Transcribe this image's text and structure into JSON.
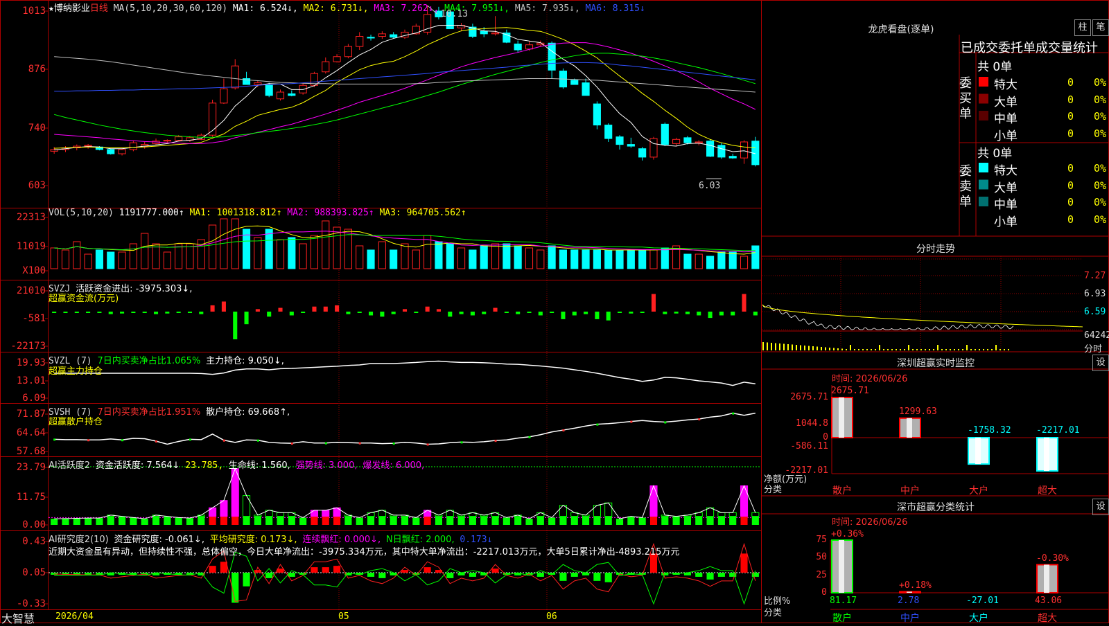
{
  "stock": {
    "star": "★",
    "name": "博纳影业",
    "period": "日线"
  },
  "colors": {
    "up": "#ff2020",
    "down": "#00ffff",
    "grid": "#8b0000",
    "panel_border": "#b00000",
    "ma1": "#ffffff",
    "ma2": "#ffff00",
    "ma3": "#ff00ff",
    "ma4": "#00ff00",
    "ma5": "#c0c0c0",
    "ma6": "#3050ff"
  },
  "kline_header": {
    "ma_def": "MA(5,10,20,30,60,120)",
    "items": [
      {
        "text": "MA1: 6.524↓",
        "color": "#ffffff"
      },
      {
        "text": "MA2: 6.731↓",
        "color": "#ffff00"
      },
      {
        "text": "MA3: 7.262↓",
        "color": "#ff00ff"
      },
      {
        "text": "MA4: 7.951↓",
        "color": "#00ff00"
      },
      {
        "text": "MA5: 7.935↓",
        "color": "#c0c0c0"
      },
      {
        "text": "MA6: 8.315↓",
        "color": "#3050ff"
      }
    ],
    "high_mark": "10.13",
    "low_mark": "6.03"
  },
  "vol_header": {
    "def": "VOL(5,10,20)",
    "v": "1191777.000↑",
    "ma1": "MA1: 1001318.812↑",
    "ma2": "MA2: 988393.825↑",
    "ma3": "MA3: 964705.562↑"
  },
  "svzj_header": {
    "def": "SVZJ",
    "label": "活跃资金进出: -3975.303↓,",
    "sub": "超赢资金流(万元)"
  },
  "svzl_header": {
    "def": "SVZL (7)",
    "label1": "7日内买卖净占比1.065%",
    "label2": "主力持仓: 9.050↓,",
    "sub": "超赢主力持仓"
  },
  "svsh_header": {
    "def": "SVSH (7)",
    "label1": "7日内买卖净占比1.951%",
    "label2": "散户持仓: 69.668↑,",
    "sub": "超赢散户持仓"
  },
  "ai2_header": {
    "def": "AI活跃度2",
    "l1": "资金活跃度: 7.564↓",
    "l2": "23.785,",
    "l3": "生命线: 1.560,",
    "l4": "强势线: 3.000,",
    "l5": "爆发线: 6.000,"
  },
  "ai3_header": {
    "def": "AI研究度2(10)",
    "l1": "资金研究度: -0.061↓,",
    "l2": "平均研究度: 0.173↓,",
    "l3": "连续飘红: 0.000↓,",
    "l4": "N日飘红: 2.000,",
    "l5": "0.173↓",
    "note": "近期大资金虽有异动，但持续性不强，总体偏空，今日大单净流出：-3975.334万元，其中特大单净流出：-2217.013万元，大单5日累计净出-4893.215万元"
  },
  "axes": {
    "price": [
      "1013",
      "876",
      "740",
      "603"
    ],
    "vol": [
      "22313",
      "11019",
      "X100"
    ],
    "svzj": [
      "21010",
      "-581",
      "-22173"
    ],
    "svzl": [
      "19.93",
      "13.01",
      "6.09"
    ],
    "svsh": [
      "71.87",
      "64.64",
      "57.68"
    ],
    "ai2": [
      "23.79",
      "11.75",
      "0.00"
    ],
    "ai3": [
      "0.43",
      "0.05",
      "-0.33"
    ]
  },
  "date_axis": {
    "brand": "大智慧",
    "d1": "2026/04",
    "d2": "05",
    "d3": "06"
  },
  "right": {
    "lhb_title": "龙虎看盘(逐单)",
    "btn_bar": "柱",
    "btn_pen": "笔",
    "stat_title": "已成交委托单成交量统计",
    "buy_side": "委买单",
    "sell_side": "委卖单",
    "buy_total": "共 0单",
    "sell_total": "共 0单",
    "rows": [
      {
        "name": "特大",
        "count": "0",
        "pct": "0%"
      },
      {
        "name": "大单",
        "count": "0",
        "pct": "0%"
      },
      {
        "name": "中单",
        "count": "0",
        "pct": "0%"
      },
      {
        "name": "小单",
        "count": "0",
        "pct": "0%"
      }
    ],
    "buy_colors": [
      "#ff0000",
      "#8b0000",
      "#5a0000",
      ""
    ],
    "sell_colors": [
      "#00ffff",
      "#008b8b",
      "#007070",
      ""
    ],
    "minute_title": "分时走势",
    "minute_axis": [
      "7.27",
      "6.93",
      "6.59",
      "64242",
      "分时"
    ],
    "sz_title": "深圳超赢实时监控",
    "sz_time": "时间: 2026/06/26",
    "sz_axis": [
      "2675.71",
      "1044.8",
      "0",
      "-586.11",
      "-2217.01"
    ],
    "sz_net": "净额(万元)",
    "sz_cat": "分类",
    "sz_bars": [
      {
        "cat": "散户",
        "value": 2675.71,
        "label": "2675.71"
      },
      {
        "cat": "中户",
        "value": 1299.63,
        "label": "1299.63"
      },
      {
        "cat": "大户",
        "value": -1758.32,
        "label": "-1758.32"
      },
      {
        "cat": "超大",
        "value": -2217.01,
        "label": "-2217.01"
      }
    ],
    "set_label": "设",
    "sc_title": "深市超赢分类统计",
    "sc_time": "时间: 2026/06/26",
    "sc_axis": [
      "75",
      "50",
      "25",
      "0"
    ],
    "sc_ratio": "比例%",
    "sc_cat": "分类",
    "sc_bars": [
      {
        "cat": "散户",
        "pct": "+0.36%",
        "level": 75,
        "value": "81.17"
      },
      {
        "cat": "中户",
        "pct": "+0.18%",
        "level": 1.5,
        "value": "2.78"
      },
      {
        "cat": "大户",
        "pct": "",
        "level": 0,
        "value": "-27.01"
      },
      {
        "cat": "超大",
        "pct": "-0.30%",
        "level": 40,
        "value": "43.06"
      }
    ]
  },
  "chart_data": {
    "type": "candlestick",
    "candles": [
      [
        6.68,
        6.78,
        6.62,
        6.72
      ],
      [
        6.72,
        6.8,
        6.66,
        6.76
      ],
      [
        6.76,
        6.84,
        6.7,
        6.8
      ],
      [
        6.8,
        6.85,
        6.74,
        6.82
      ],
      [
        6.78,
        6.8,
        6.7,
        6.72
      ],
      [
        6.72,
        6.74,
        6.6,
        6.62
      ],
      [
        6.62,
        6.74,
        6.58,
        6.72
      ],
      [
        6.72,
        6.92,
        6.68,
        6.88
      ],
      [
        6.8,
        6.9,
        6.74,
        6.84
      ],
      [
        6.86,
        6.98,
        6.84,
        6.92
      ],
      [
        6.92,
        6.96,
        6.88,
        6.94
      ],
      [
        6.94,
        7.06,
        6.92,
        7.02
      ],
      [
        6.94,
        7.04,
        6.9,
        7.0
      ],
      [
        6.96,
        7.1,
        6.94,
        7.06
      ],
      [
        7.06,
        7.9,
        7.02,
        7.82
      ],
      [
        7.82,
        8.4,
        7.8,
        8.16
      ],
      [
        8.18,
        8.86,
        8.14,
        8.7
      ],
      [
        8.4,
        8.56,
        8.28,
        8.26
      ],
      [
        8.26,
        8.36,
        8.2,
        8.3
      ],
      [
        8.24,
        8.3,
        7.96,
        8.0
      ],
      [
        7.92,
        8.14,
        7.88,
        8.08
      ],
      [
        8.04,
        8.12,
        7.98,
        8.0
      ],
      [
        8.06,
        8.3,
        8.02,
        8.24
      ],
      [
        8.24,
        8.56,
        8.2,
        8.52
      ],
      [
        8.56,
        8.9,
        8.52,
        8.8
      ],
      [
        8.8,
        8.98,
        8.78,
        8.92
      ],
      [
        8.92,
        9.22,
        8.88,
        9.16
      ],
      [
        9.16,
        9.5,
        9.08,
        9.4
      ],
      [
        9.38,
        9.44,
        9.3,
        9.36
      ],
      [
        9.4,
        9.52,
        9.34,
        9.46
      ],
      [
        9.44,
        9.5,
        9.36,
        9.38
      ],
      [
        9.38,
        9.56,
        9.34,
        9.5
      ],
      [
        9.46,
        9.7,
        9.44,
        9.64
      ],
      [
        9.5,
        10.13,
        9.44,
        9.92
      ],
      [
        10.0,
        10.1,
        9.8,
        9.86
      ],
      [
        9.98,
        10.0,
        9.6,
        9.58
      ],
      [
        9.6,
        9.72,
        9.52,
        9.66
      ],
      [
        9.62,
        9.7,
        9.36,
        9.4
      ],
      [
        9.52,
        9.62,
        9.38,
        9.46
      ],
      [
        9.46,
        9.88,
        9.42,
        9.48
      ],
      [
        9.48,
        9.56,
        9.24,
        9.26
      ],
      [
        9.22,
        9.3,
        9.02,
        9.08
      ],
      [
        9.1,
        9.28,
        9.06,
        9.2
      ],
      [
        9.2,
        9.3,
        9.16,
        9.24
      ],
      [
        9.24,
        9.28,
        8.4,
        8.6
      ],
      [
        8.58,
        8.64,
        8.16,
        8.2
      ],
      [
        8.36,
        8.4,
        8.26,
        8.26
      ],
      [
        8.3,
        8.4,
        8.0,
        8.0
      ],
      [
        7.8,
        7.86,
        7.2,
        7.3
      ],
      [
        7.3,
        7.34,
        6.9,
        6.98
      ],
      [
        7.02,
        7.06,
        6.72,
        6.84
      ],
      [
        6.84,
        7.0,
        6.76,
        6.8
      ],
      [
        6.74,
        6.78,
        6.46,
        6.54
      ],
      [
        6.54,
        7.02,
        6.48,
        6.98
      ],
      [
        7.32,
        7.36,
        6.8,
        6.84
      ],
      [
        6.86,
        7.0,
        6.8,
        6.96
      ],
      [
        7.0,
        7.04,
        6.84,
        6.88
      ],
      [
        6.88,
        6.94,
        6.82,
        6.9
      ],
      [
        6.92,
        6.96,
        6.54,
        6.56
      ],
      [
        6.82,
        6.88,
        6.5,
        6.54
      ],
      [
        6.56,
        6.62,
        6.5,
        6.52
      ],
      [
        6.52,
        6.94,
        6.38,
        6.9
      ],
      [
        6.92,
        7.02,
        6.32,
        6.36
      ]
    ],
    "ma": {
      "MA1": [
        6.71,
        6.74,
        6.77,
        6.79,
        6.78,
        6.74,
        6.74,
        6.77,
        6.8,
        6.83,
        6.86,
        6.92,
        6.94,
        6.98,
        7.17,
        7.41,
        7.75,
        7.98,
        8.24,
        8.28,
        8.27,
        8.14,
        8.14,
        8.23,
        8.42,
        8.59,
        8.78,
        8.96,
        9.09,
        9.26,
        9.35,
        9.42,
        9.48,
        9.58,
        9.66,
        9.66,
        9.66,
        9.6,
        9.53,
        9.52,
        9.44,
        9.33,
        9.29,
        9.25,
        9.05,
        8.86,
        8.7,
        8.47,
        8.2,
        7.87,
        7.57,
        7.36,
        7.03,
        6.86,
        6.82,
        6.8,
        6.86,
        6.87,
        6.82,
        6.74,
        6.67,
        6.69,
        6.62
      ],
      "MA2": [
        6.75,
        6.76,
        6.77,
        6.78,
        6.77,
        6.76,
        6.76,
        6.77,
        6.78,
        6.8,
        6.82,
        6.84,
        6.86,
        6.89,
        6.99,
        7.09,
        7.27,
        7.39,
        7.53,
        7.6,
        7.67,
        7.72,
        7.83,
        7.98,
        8.12,
        8.31,
        8.46,
        8.61,
        8.71,
        8.77,
        8.81,
        8.92,
        9.05,
        9.2,
        9.32,
        9.44,
        9.53,
        9.57,
        9.58,
        9.6,
        9.61,
        9.58,
        9.54,
        9.52,
        9.43,
        9.33,
        9.2,
        9.05,
        8.89,
        8.67,
        8.46,
        8.26,
        8.05,
        7.86,
        7.65,
        7.46,
        7.25,
        7.08,
        6.96,
        6.88,
        6.82,
        6.78,
        6.76
      ],
      "MA3": [
        7.08,
        7.06,
        7.04,
        7.02,
        7.0,
        6.97,
        6.95,
        6.93,
        6.91,
        6.9,
        6.88,
        6.87,
        6.86,
        6.86,
        6.88,
        6.92,
        7.0,
        7.06,
        7.13,
        7.19,
        7.26,
        7.32,
        7.4,
        7.48,
        7.56,
        7.65,
        7.74,
        7.84,
        7.92,
        8.0,
        8.08,
        8.17,
        8.27,
        8.37,
        8.48,
        8.58,
        8.68,
        8.76,
        8.83,
        8.9,
        8.96,
        9.02,
        9.09,
        9.16,
        9.21,
        9.24,
        9.25,
        9.25,
        9.21,
        9.15,
        9.08,
        9.0,
        8.91,
        8.81,
        8.7,
        8.59,
        8.46,
        8.32,
        8.17,
        8.04,
        7.91,
        7.8,
        7.67
      ],
      "MA4": [
        7.55,
        7.48,
        7.42,
        7.36,
        7.3,
        7.25,
        7.2,
        7.16,
        7.12,
        7.09,
        7.06,
        7.04,
        7.02,
        7.01,
        7.01,
        7.02,
        7.05,
        7.08,
        7.12,
        7.15,
        7.18,
        7.22,
        7.26,
        7.31,
        7.36,
        7.42,
        7.49,
        7.56,
        7.63,
        7.7,
        7.77,
        7.84,
        7.92,
        8.0,
        8.08,
        8.17,
        8.26,
        8.34,
        8.42,
        8.5,
        8.57,
        8.64,
        8.71,
        8.78,
        8.84,
        8.89,
        8.94,
        8.98,
        9.0,
        9.0,
        8.98,
        8.96,
        8.93,
        8.89,
        8.84,
        8.78,
        8.72,
        8.66,
        8.59,
        8.52,
        8.44,
        8.36,
        8.28
      ],
      "MA5": [
        8.92,
        8.9,
        8.88,
        8.86,
        8.83,
        8.8,
        8.76,
        8.72,
        8.68,
        8.64,
        8.6,
        8.56,
        8.52,
        8.49,
        8.46,
        8.43,
        8.4,
        8.37,
        8.35,
        8.33,
        8.31,
        8.3,
        8.29,
        8.28,
        8.28,
        8.27,
        8.27,
        8.27,
        8.27,
        8.27,
        8.27,
        8.27,
        8.28,
        8.29,
        8.31,
        8.32,
        8.34,
        8.35,
        8.36,
        8.37,
        8.38,
        8.39,
        8.4,
        8.4,
        8.4,
        8.39,
        8.38,
        8.37,
        8.36,
        8.34,
        8.32,
        8.3,
        8.28,
        8.26,
        8.24,
        8.22,
        8.2,
        8.18,
        8.16,
        8.14,
        8.12,
        8.1,
        8.08
      ],
      "MA6": [
        8.1,
        8.1,
        8.11,
        8.11,
        8.12,
        8.12,
        8.13,
        8.13,
        8.14,
        8.14,
        8.15,
        8.16,
        8.16,
        8.17,
        8.18,
        8.19,
        8.2,
        8.22,
        8.24,
        8.26,
        8.27,
        8.28,
        8.3,
        8.32,
        8.34,
        8.36,
        8.38,
        8.4,
        8.42,
        8.44,
        8.46,
        8.48,
        8.5,
        8.52,
        8.55,
        8.57,
        8.59,
        8.61,
        8.63,
        8.65,
        8.67,
        8.7,
        8.72,
        8.74,
        8.76,
        8.77,
        8.78,
        8.78,
        8.77,
        8.75,
        8.72,
        8.7,
        8.67,
        8.64,
        8.61,
        8.58,
        8.55,
        8.52,
        8.49,
        8.46,
        8.43,
        8.4,
        8.37
      ]
    },
    "volume": [
      1000,
      900,
      1300,
      700,
      900,
      800,
      800,
      1200,
      1700,
      1200,
      800,
      1200,
      1200,
      1400,
      2100,
      2400,
      2400,
      1900,
      1500,
      1900,
      1400,
      1500,
      1200,
      1600,
      2300,
      2000,
      1900,
      1100,
      900,
      1300,
      900,
      1200,
      900,
      1600,
      1300,
      1200,
      1000,
      900,
      1100,
      1200,
      1200,
      1100,
      1000,
      900,
      1100,
      900,
      900,
      900,
      900,
      900,
      900,
      900,
      900,
      900,
      1000,
      1100,
      700,
      700,
      600,
      800,
      800,
      600,
      1100
    ],
    "svzj": [
      -500,
      -600,
      -700,
      -800,
      -800,
      -2000,
      -1500,
      -1000,
      -500,
      -2000,
      -1500,
      -1000,
      -800,
      -2000,
      5000,
      8000,
      -22000,
      -10000,
      2000,
      -4000,
      3000,
      -3000,
      -1000,
      4000,
      4000,
      5000,
      -2000,
      -1000,
      -3000,
      -4000,
      -2000,
      2000,
      -1000,
      4000,
      2000,
      -4000,
      -2000,
      -3000,
      -2000,
      3000,
      -1000,
      -2000,
      -500,
      -3000,
      -1000,
      -6000,
      -3000,
      -2000,
      -6000,
      -7000,
      -500,
      -1500,
      -1000,
      14000,
      -2000,
      -1500,
      -2000,
      -3000,
      -5000,
      -3000,
      -3000,
      14000,
      -3000
    ],
    "svzl": [
      13.0,
      13.0,
      13.0,
      13.0,
      13.0,
      13.0,
      13.0,
      13.0,
      13.0,
      13.0,
      13.0,
      13.0,
      13.0,
      12.9,
      12.6,
      13.1,
      14.2,
      14.6,
      14.6,
      14.3,
      14.7,
      14.8,
      15.0,
      15.2,
      15.4,
      15.6,
      15.9,
      16.1,
      16.6,
      16.6,
      16.6,
      16.8,
      17.0,
      17.3,
      17.5,
      17.2,
      17.0,
      17.0,
      16.9,
      16.7,
      16.4,
      16.3,
      16.0,
      15.7,
      15.3,
      14.9,
      14.3,
      13.7,
      13.0,
      12.2,
      11.4,
      10.8,
      10.0,
      10.5,
      11.5,
      11.3,
      10.8,
      10.2,
      9.8,
      9.4,
      8.5,
      9.7,
      9.1
    ],
    "svsh": [
      61.2,
      61.1,
      61.1,
      61.0,
      61.0,
      61.3,
      61.0,
      61.5,
      61.4,
      60.6,
      59.6,
      60.5,
      61.2,
      61.1,
      62.9,
      60.9,
      60.2,
      61.0,
      60.9,
      60.2,
      60.0,
      59.9,
      60.4,
      60.0,
      60.0,
      60.2,
      60.1,
      60.0,
      60.0,
      59.8,
      59.9,
      60.2,
      60.0,
      59.6,
      59.7,
      60.1,
      60.3,
      60.2,
      60.4,
      60.8,
      61.0,
      61.6,
      62.0,
      62.7,
      63.6,
      64.2,
      64.8,
      65.5,
      66.1,
      66.3,
      66.6,
      67.0,
      67.3,
      67.0,
      66.8,
      67.1,
      67.5,
      67.8,
      68.4,
      68.8,
      69.7,
      69.0,
      69.7
    ]
  }
}
